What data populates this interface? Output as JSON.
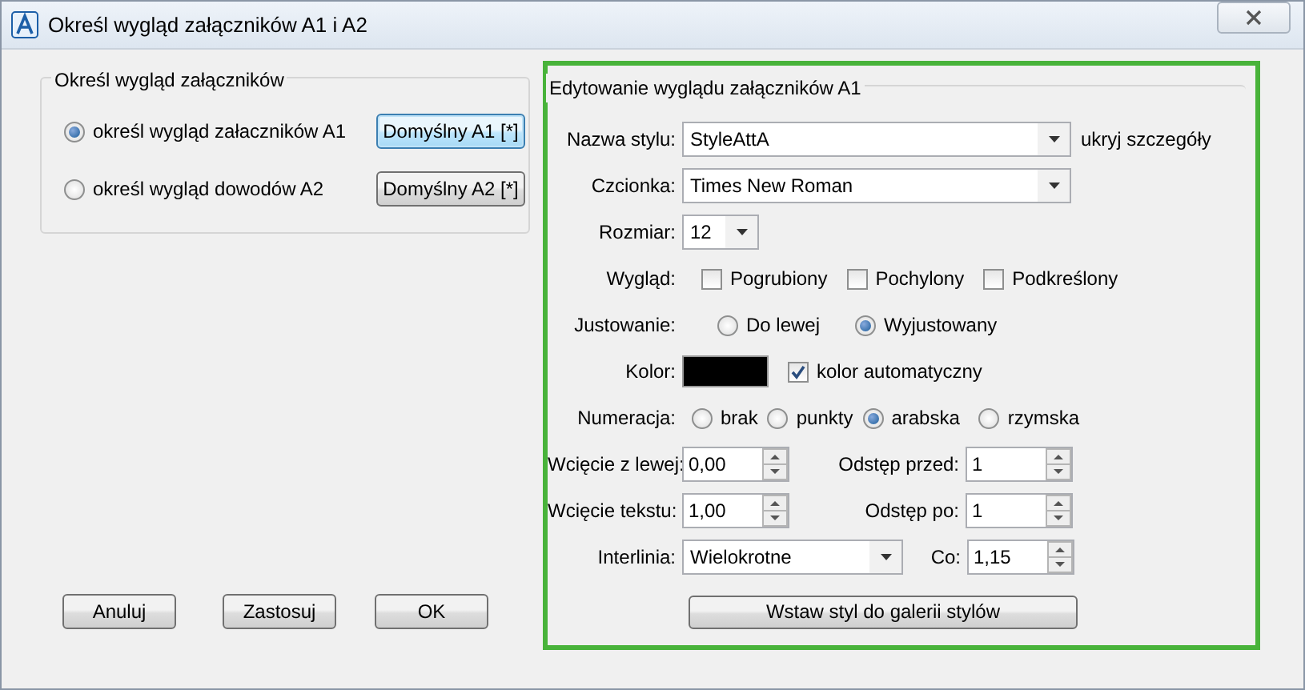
{
  "window": {
    "title": "Określ wygląd załączników A1 i A2"
  },
  "left_group": {
    "title": "Określ wygląd załączników",
    "options": [
      {
        "label": "określ wygląd załaczników A1",
        "selected": true
      },
      {
        "label": "określ wygląd dowodów A2",
        "selected": false
      }
    ],
    "default_buttons": [
      {
        "label": "Domyślny A1 [*]",
        "focused": true
      },
      {
        "label": "Domyślny A2 [*]",
        "focused": false
      }
    ]
  },
  "editor": {
    "title": "Edytowanie wyglądu załączników A1",
    "style_name": {
      "label": "Nazwa stylu:",
      "value": "StyleAttA",
      "link": "ukryj szczegóły"
    },
    "font": {
      "label": "Czcionka:",
      "value": "Times New Roman"
    },
    "size": {
      "label": "Rozmiar:",
      "value": "12"
    },
    "appearance": {
      "label": "Wygląd:",
      "options": [
        {
          "label": "Pogrubiony",
          "checked": false
        },
        {
          "label": "Pochylony",
          "checked": false
        },
        {
          "label": "Podkreślony",
          "checked": false
        }
      ]
    },
    "alignment": {
      "label": "Justowanie:",
      "options": [
        {
          "label": "Do lewej",
          "selected": false
        },
        {
          "label": "Wyjustowany",
          "selected": true
        }
      ]
    },
    "color": {
      "label": "Kolor:",
      "color": "#000000",
      "auto": {
        "label": "kolor automatyczny",
        "checked": true
      }
    },
    "numbering": {
      "label": "Numeracja:",
      "options": [
        {
          "label": "brak",
          "selected": false
        },
        {
          "label": "punkty",
          "selected": false
        },
        {
          "label": "arabska",
          "selected": true
        },
        {
          "label": "rzymska",
          "selected": false
        }
      ]
    },
    "left_indent": {
      "label": "Wcięcie z lewej:",
      "value": "0,00"
    },
    "spacing_before": {
      "label": "Odstęp przed:",
      "value": "1"
    },
    "text_indent": {
      "label": "Wcięcie tekstu:",
      "value": "1,00"
    },
    "spacing_after": {
      "label": "Odstęp po:",
      "value": "1"
    },
    "line_spacing": {
      "label": "Interlinia:",
      "value": "Wielokrotne"
    },
    "every": {
      "label": "Co:",
      "value": "1,15"
    },
    "insert_button": "Wstaw styl do galerii stylów"
  },
  "buttons": [
    "Anuluj",
    "Zastosuj",
    "OK"
  ]
}
